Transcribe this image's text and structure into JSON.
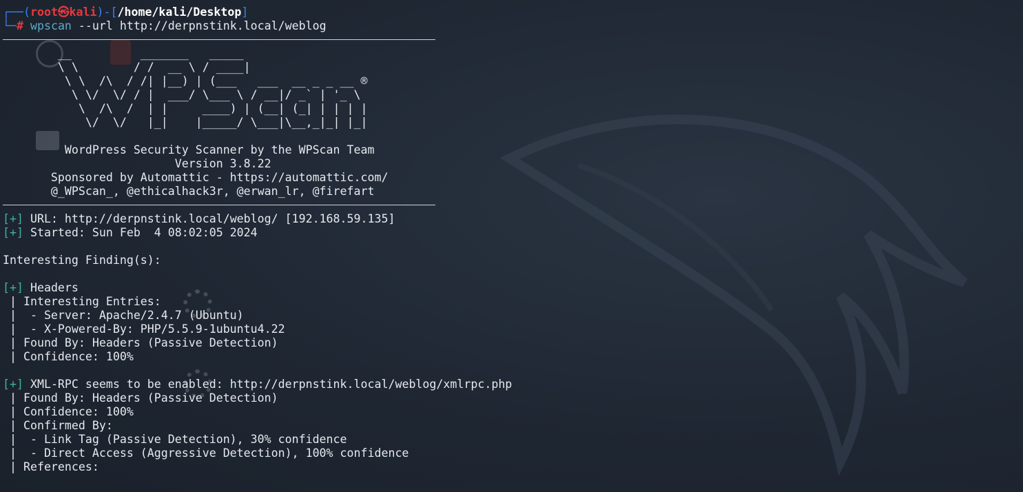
{
  "prompt": {
    "bracket_top": "┌──(",
    "user": "root",
    "skull": "㉿",
    "host": "kali",
    "sep": ")-[",
    "cwd": "/home/kali/Desktop",
    "close": "]",
    "bracket_bottom": "└─",
    "hash": "#",
    "command": "wpscan",
    "args": " --url http://derpnstink.local/weblog"
  },
  "banner": [
    "        __          _______   _____",
    "        \\ \\        / /  __ \\ / ____|",
    "         \\ \\  /\\  / /| |__) | (___   ___  __ _ _ __ ®",
    "          \\ \\/  \\/ / |  ___/ \\___ \\ / __|/ _` | '_ \\",
    "           \\  /\\  /  | |     ____) | (__| (_| | | | |",
    "            \\/  \\/   |_|    |_____/ \\___|\\__,_|_| |_|"
  ],
  "credits": [
    "         WordPress Security Scanner by the WPScan Team",
    "                         Version 3.8.22",
    "       Sponsored by Automattic - https://automattic.com/",
    "       @_WPScan_, @ethicalhack3r, @erwan_lr, @firefart"
  ],
  "scan": {
    "tag": "[+]",
    "url_line": " URL: http://derpnstink.local/weblog/ [192.168.59.135]",
    "started_line": " Started: Sun Feb  4 08:02:05 2024",
    "interesting": "Interesting Finding(s):"
  },
  "headers_block": {
    "title": " Headers",
    "lines": [
      " | Interesting Entries:",
      " |  - Server: Apache/2.4.7 (Ubuntu)",
      " |  - X-Powered-By: PHP/5.5.9-1ubuntu4.22",
      " | Found By: Headers (Passive Detection)",
      " | Confidence: 100%"
    ]
  },
  "xmlrpc_block": {
    "title": " XML-RPC seems to be enabled: http://derpnstink.local/weblog/xmlrpc.php",
    "lines": [
      " | Found By: Headers (Passive Detection)",
      " | Confidence: 100%",
      " | Confirmed By:",
      " |  - Link Tag (Passive Detection), 30% confidence",
      " |  - Direct Access (Aggressive Detection), 100% confidence",
      " | References:"
    ]
  },
  "colors": {
    "background": "#1f2733",
    "prompt_blue": "#3d7ef5",
    "prompt_red": "#e8383d",
    "tag_green": "#3fb39f",
    "text": "#e6e9ee"
  }
}
